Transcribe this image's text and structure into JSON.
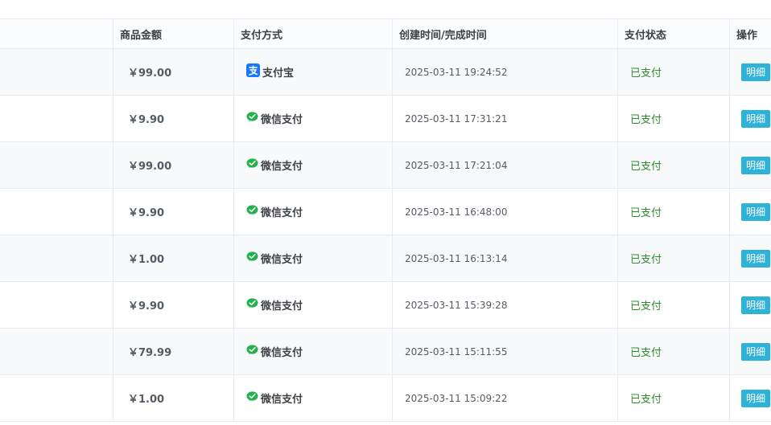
{
  "header": {
    "amount": "商品金额",
    "payment": "支付方式",
    "time": "创建时间/完成时间",
    "status": "支付状态",
    "action": "操作"
  },
  "colors": {
    "wechat": "#22b14c",
    "alipay": "#1677ff",
    "status": "#2e8c2e",
    "button": "#2fb2d8"
  },
  "rows": [
    {
      "amount": "￥99.00",
      "method": "alipay",
      "method_label": "支付宝",
      "time": "2025-03-11 19:24:52",
      "status": "已支付",
      "action": "明细"
    },
    {
      "amount": "￥9.90",
      "method": "wechat",
      "method_label": "微信支付",
      "time": "2025-03-11 17:31:21",
      "status": "已支付",
      "action": "明细"
    },
    {
      "amount": "￥99.00",
      "method": "wechat",
      "method_label": "微信支付",
      "time": "2025-03-11 17:21:04",
      "status": "已支付",
      "action": "明细"
    },
    {
      "amount": "￥9.90",
      "method": "wechat",
      "method_label": "微信支付",
      "time": "2025-03-11 16:48:00",
      "status": "已支付",
      "action": "明细"
    },
    {
      "amount": "￥1.00",
      "method": "wechat",
      "method_label": "微信支付",
      "time": "2025-03-11 16:13:14",
      "status": "已支付",
      "action": "明细"
    },
    {
      "amount": "￥9.90",
      "method": "wechat",
      "method_label": "微信支付",
      "time": "2025-03-11 15:39:28",
      "status": "已支付",
      "action": "明细"
    },
    {
      "amount": "￥79.99",
      "method": "wechat",
      "method_label": "微信支付",
      "time": "2025-03-11 15:11:55",
      "status": "已支付",
      "action": "明细"
    },
    {
      "amount": "￥1.00",
      "method": "wechat",
      "method_label": "微信支付",
      "time": "2025-03-11 15:09:22",
      "status": "已支付",
      "action": "明细"
    }
  ]
}
